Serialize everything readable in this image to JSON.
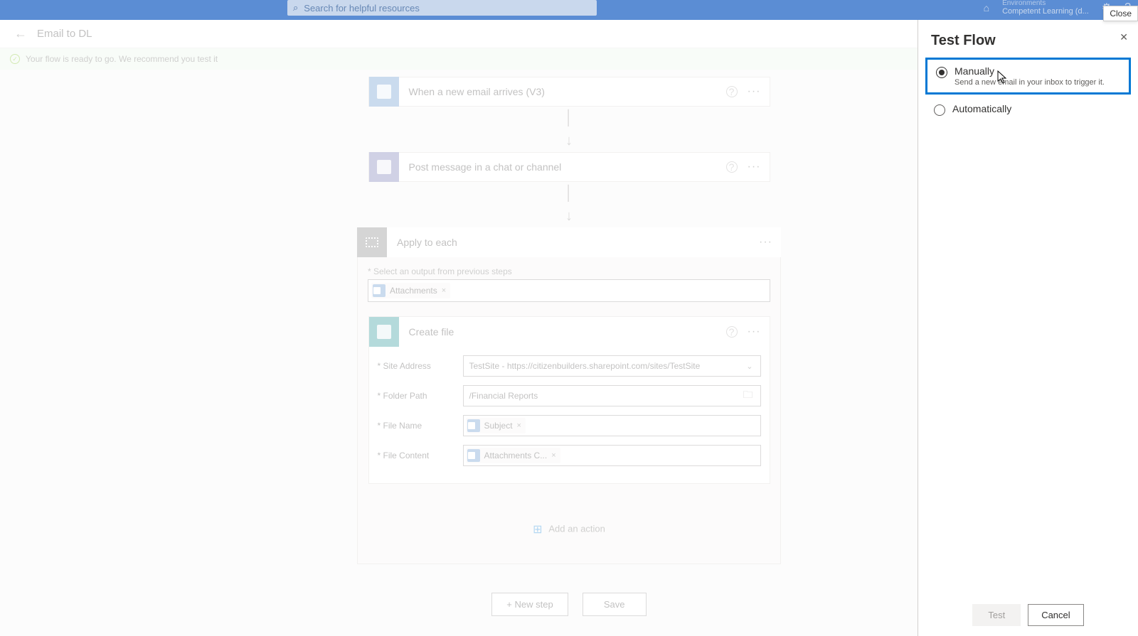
{
  "top": {
    "search_placeholder": "Search for helpful resources",
    "env_label": "Environments",
    "env_name": "Competent Learning (d...",
    "close_tooltip": "Close"
  },
  "header": {
    "flow_name": "Email to DL"
  },
  "banner": {
    "message": "Your flow is ready to go. We recommend you test it"
  },
  "steps": {
    "trigger": {
      "title": "When a new email arrives (V3)"
    },
    "action1": {
      "title": "Post message in a chat or channel"
    },
    "scope": {
      "title": "Apply to each",
      "input_label": "* Select an output from previous steps",
      "token": "Attachments"
    },
    "create_file": {
      "title": "Create file",
      "fields": {
        "site_label": "* Site Address",
        "site_value": "TestSite - https://citizenbuilders.sharepoint.com/sites/TestSite",
        "folder_label": "* Folder Path",
        "folder_value": "/Financial Reports",
        "filename_label": "* File Name",
        "filename_token": "Subject",
        "content_label": "* File Content",
        "content_token": "Attachments C..."
      }
    },
    "add_action": "Add an action"
  },
  "buttons": {
    "new_step": "+ New step",
    "save": "Save"
  },
  "panel": {
    "title": "Test Flow",
    "manually": "Manually",
    "manually_sub": "Send a new email in your inbox to trigger it.",
    "automatically": "Automatically",
    "test": "Test",
    "cancel": "Cancel"
  }
}
